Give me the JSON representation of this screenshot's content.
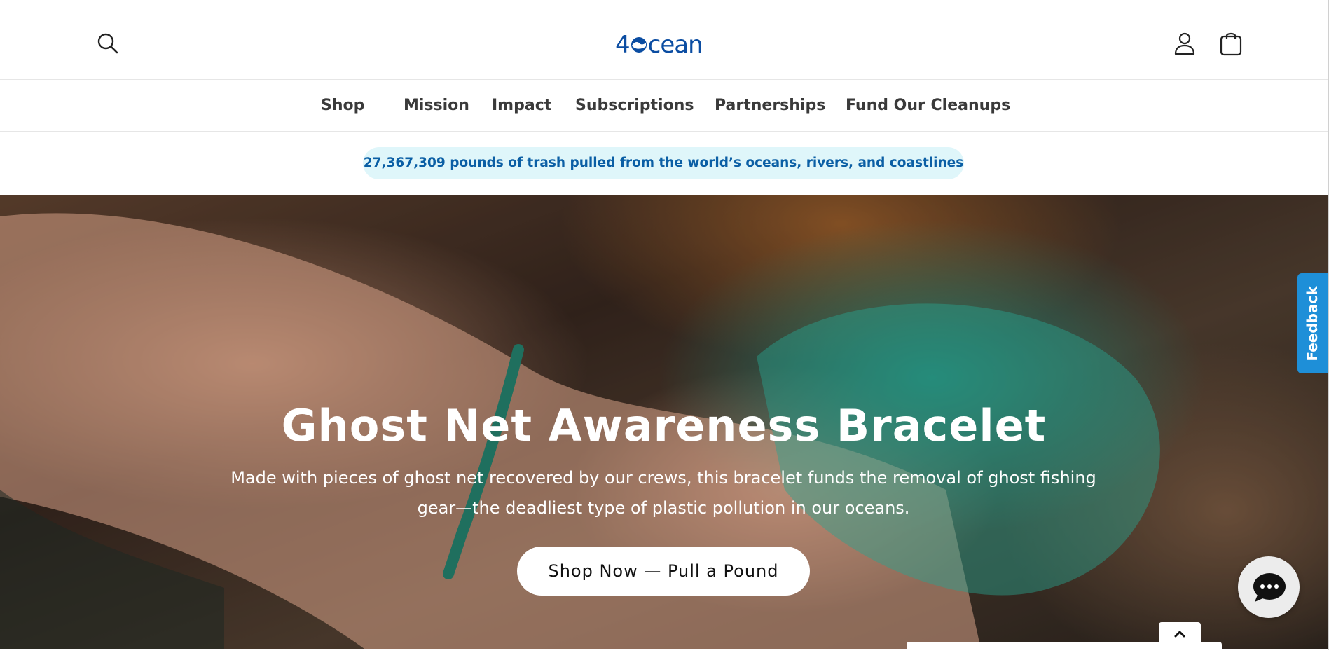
{
  "header": {
    "logo_text": "4Ocean",
    "logo_prefix": "4",
    "logo_suffix": "cean",
    "icons": [
      "search-icon",
      "user-icon",
      "shopping-bag-icon"
    ]
  },
  "nav": {
    "items": [
      {
        "label": "Shop"
      },
      {
        "label": "Mission"
      },
      {
        "label": "Impact"
      },
      {
        "label": "Subscriptions"
      },
      {
        "label": "Partnerships"
      },
      {
        "label": "Fund Our Cleanups"
      }
    ]
  },
  "banner": {
    "counter_text": "27,367,309 pounds of trash pulled from the world’s oceans, rivers, and coastlines"
  },
  "hero": {
    "title": "Ghost Net Awareness Bracelet",
    "subtitle": "Made with pieces of ghost net recovered by our crews, this bracelet funds the removal of ghost fishing gear—the deadliest type of plastic pollution in our oceans.",
    "cta_label": "Shop Now — Pull a Pound"
  },
  "widgets": {
    "feedback_label": "Feedback",
    "chat_icon": "chat-bubble-icon",
    "scroll_icon": "chevron-up-icon"
  },
  "colors": {
    "brand_blue": "#0b4da2",
    "pill_background": "#dff6fa",
    "pill_text": "#0b5fa5",
    "feedback_blue": "#1e8fd8"
  }
}
